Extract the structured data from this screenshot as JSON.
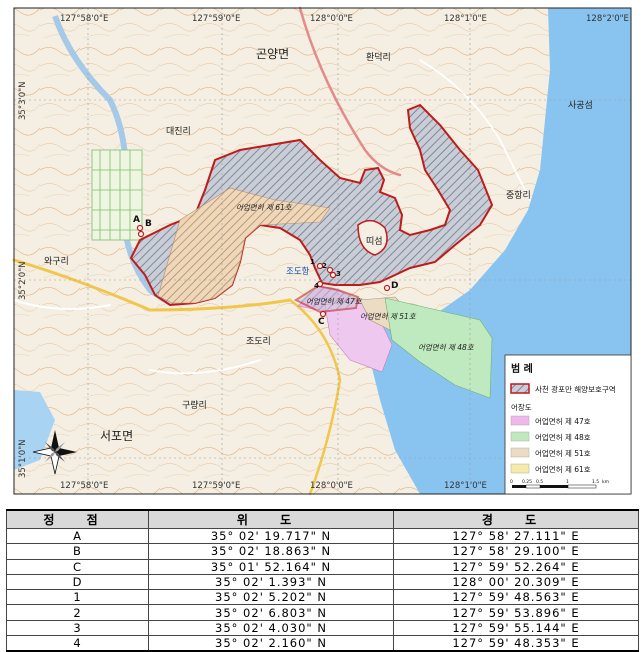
{
  "map": {
    "grid_labels": {
      "top": [
        "127°58'0\"E",
        "127°59'0\"E",
        "128°0'0\"E",
        "128°1'0\"E",
        "128°2'0\"E"
      ],
      "bottom": [
        "127°58'0\"E",
        "127°59'0\"E",
        "128°0'0\"E",
        "128°1'0\"E"
      ],
      "left": [
        "35°3'0\"N",
        "35°2'0\"N",
        "35°1'0\"N"
      ]
    },
    "place_names": {
      "goyang": "곤양면",
      "hwandeok": "환덕리",
      "saryang": "사공섬",
      "daejin": "대진리",
      "junghang": "중항리",
      "tiseom": "띠섬",
      "oguri": "와구리",
      "jodohang": "조도항",
      "jodori": "조도리",
      "guryang": "구량리",
      "seopo": "서포면"
    },
    "zone_labels": {
      "fishery61": "어업면허 제 61호",
      "fishery47": "어업면허 제 47호",
      "fishery51": "어업면허 제 51호",
      "fishery48": "어업면허 제 48호"
    },
    "point_labels": [
      "A",
      "B",
      "C",
      "D",
      "1",
      "2",
      "3",
      "4"
    ],
    "legend": {
      "title": "범 례",
      "protected_area": "사천 광포만 해양보호구역",
      "subtitle": "어장도",
      "items": [
        {
          "label": "어업면허 제 47호",
          "color": "#efb8ef"
        },
        {
          "label": "어업면허 제 48호",
          "color": "#bfe9bf"
        },
        {
          "label": "어업면허 제 51호",
          "color": "#ecdcc4"
        },
        {
          "label": "어업면허 제 61호",
          "color": "#f4eba8"
        }
      ],
      "scale_ticks": [
        "0",
        "0.25",
        "0.5",
        "1",
        "1.5"
      ],
      "scale_unit": "km"
    },
    "colors": {
      "land": "#f5f1e6",
      "sea": "#89c4f0",
      "boundary": "#c01a1a",
      "hatch": "#9aa5b8"
    }
  },
  "table": {
    "headers": [
      "정 점",
      "위 도",
      "경 도"
    ],
    "rows": [
      [
        "A",
        "35°  02'  19.717\"  N",
        "127°  58'  27.111\"  E"
      ],
      [
        "B",
        "35°  02'  18.863\"  N",
        "127°  58'  29.100\"  E"
      ],
      [
        "C",
        "35°  01'  52.164\"  N",
        "127°  59'  52.264\"  E"
      ],
      [
        "D",
        "35°  02'  1.393\"  N",
        "128°  00'  20.309\"  E"
      ],
      [
        "1",
        "35°  02'  5.202\"  N",
        "127°  59'  48.563\"  E"
      ],
      [
        "2",
        "35°  02'  6.803\"  N",
        "127°  59'  53.896\"  E"
      ],
      [
        "3",
        "35°  02'  4.030\"  N",
        "127°  59'  55.144\"  E"
      ],
      [
        "4",
        "35°  02'  2.160\"  N",
        "127°  59'  48.353\"  E"
      ]
    ]
  }
}
